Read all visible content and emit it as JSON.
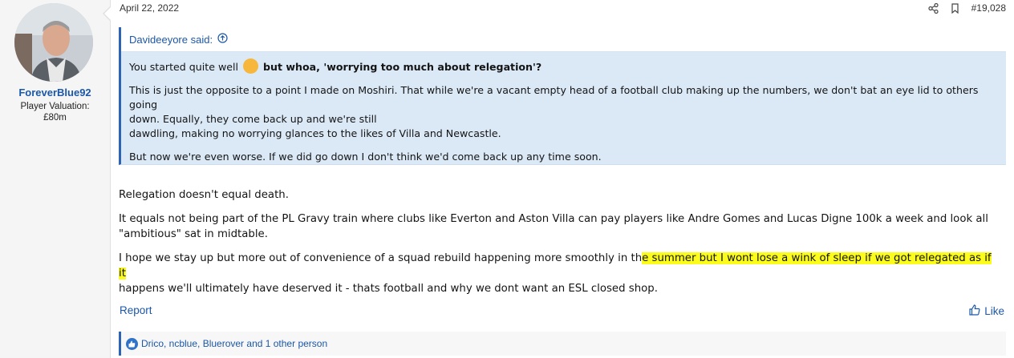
{
  "user": {
    "name": "ForeverBlue92",
    "valuation_lines": [
      "Player Valuation:",
      "£80m"
    ]
  },
  "post": {
    "date": "April 22, 2022",
    "number": "#19,028",
    "report_label": "Report",
    "like_label": "Like",
    "reactions_text": "Drico, ncblue, Bluerover and 1 other person"
  },
  "quote": {
    "author": "Davideeyore said:",
    "line1_plain": "You started quite well",
    "line1_bold": "but whoa, 'worrying too much about relegation'?",
    "para2_line1": "This is just the opposite to a point I made on Moshiri. That while we're a vacant empty head of a football club making up the numbers, we don't bat an eye lid to others going",
    "para2_line2": "down. Equally, they come back up and we're still",
    "para2_line3": "dawdling, making no worrying glances to the likes of Villa and Newcastle.",
    "para3": "But now we're even worse. If we did go down I don't think we'd come back up any time soon."
  },
  "message": {
    "p1": "Relegation doesn't equal death.",
    "p2_line1": "It equals not being part of the PL Gravy train where clubs like Everton and Aston Villa can pay players like Andre Gomes and Lucas Digne 100k a week and look all",
    "p2_line2": "\"ambitious\" sat in midtable.",
    "p3_line1_plain": "I hope we stay up but more out of convenience of a squad rebuild happening more smoothly in th",
    "p3_line1_hl": "e summer but I wont lose a wink of sleep if we got relegated as if it",
    "p3_line2": "happens we'll ultimately have deserved it - thats football and why we dont want an ESL closed shop."
  },
  "icons": [
    "share-icon",
    "bookmark-icon",
    "arrow-up-circle-icon",
    "clapping-hands-emoji",
    "thumbs-up-icon",
    "like-badge-icon"
  ],
  "colors": {
    "link": "#1b57a8",
    "quote_bg": "#dbe9f7",
    "quote_border": "#2c63b5",
    "highlight": "#fcfc1c"
  }
}
